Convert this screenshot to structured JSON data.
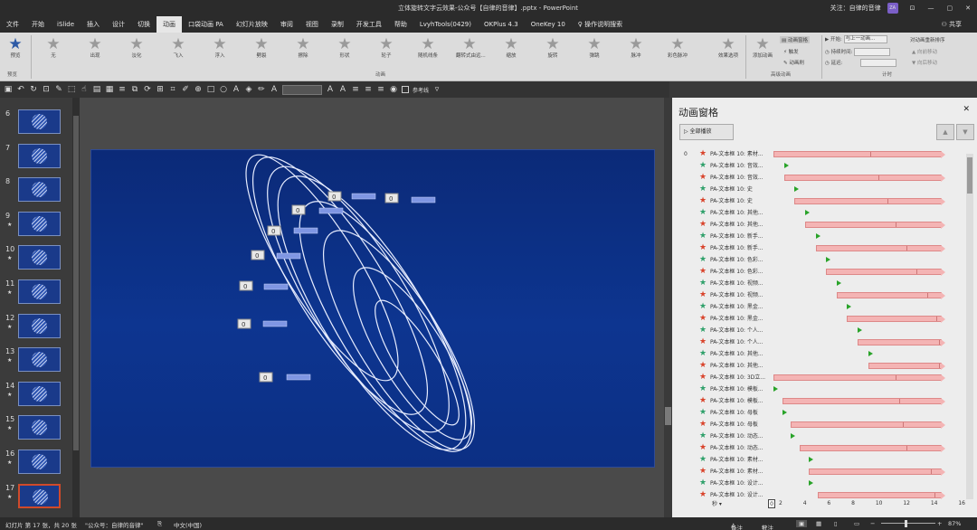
{
  "titlebar": {
    "title": "立体旋转文字云效果-公众号【自律的音律】.pptx - PowerPoint",
    "account": "关注：自律的音律",
    "avatar": "ZA",
    "minimize": "—",
    "restore": "▢",
    "close": "✕"
  },
  "tabs": [
    "文件",
    "开始",
    "iSlide",
    "插入",
    "设计",
    "切换",
    "动画",
    "口袋动画 PA",
    "幻灯片放映",
    "审阅",
    "视图",
    "录制",
    "开发工具",
    "帮助",
    "LvyhTools(0429)",
    "OKPlus 4.3",
    "OneKey 10",
    "操作说明搜索"
  ],
  "share": "共享",
  "ribbon": {
    "preview": {
      "label": "预览",
      "group": "预览"
    },
    "effects": [
      "无",
      "出现",
      "淡化",
      "飞入",
      "浮入",
      "劈裂",
      "擦除",
      "形状",
      "轮子",
      "随机线条",
      "翻转式由远...",
      "缩放",
      "旋转",
      "弹跳",
      "脉冲",
      "彩色脉冲"
    ],
    "effect_options": "效果选项",
    "group_anim": "动画",
    "add_anim": "添加动画",
    "anim_pane_btn": "动画窗格",
    "trigger": "触发",
    "anim_painter": "动画刷",
    "group_adv": "高级动画",
    "start_label": "开始:",
    "start_value": "与上一动画...",
    "duration_label": "持续时间:",
    "delay_label": "延迟:",
    "group_timing": "计时",
    "reorder": "对动画重新排序",
    "move_earlier": "向前移动",
    "move_later": "向后移动"
  },
  "qat": {
    "ref_label": "参考线"
  },
  "thumbnails": [
    {
      "num": "6",
      "star": ""
    },
    {
      "num": "7",
      "star": ""
    },
    {
      "num": "8",
      "star": ""
    },
    {
      "num": "9",
      "star": "★"
    },
    {
      "num": "10",
      "star": "★"
    },
    {
      "num": "11",
      "star": "★"
    },
    {
      "num": "12",
      "star": "★"
    },
    {
      "num": "13",
      "star": "★"
    },
    {
      "num": "14",
      "star": "★"
    },
    {
      "num": "15",
      "star": "★"
    },
    {
      "num": "16",
      "star": "★"
    },
    {
      "num": "17",
      "star": "★"
    }
  ],
  "slide": {
    "zero_label": "0"
  },
  "pane": {
    "title": "动画窗格",
    "close": "✕",
    "play_all": "全部播放",
    "up": "▲",
    "down": "▼",
    "rows": [
      {
        "idx": "0",
        "star": "red",
        "name": "PA-文本框 10: 素材...",
        "kind": "bar",
        "start": 0,
        "end": 0.96,
        "mark": 0.55
      },
      {
        "idx": "",
        "star": "green",
        "name": "PA-文本框 10: 音效...",
        "kind": "tri",
        "start": 0.06
      },
      {
        "idx": "",
        "star": "red",
        "name": "PA-文本框 10: 音效...",
        "kind": "bar",
        "start": 0.06,
        "end": 0.96,
        "mark": 0.6
      },
      {
        "idx": "",
        "star": "green",
        "name": "PA-文本框 10: 史",
        "kind": "tri",
        "start": 0.12
      },
      {
        "idx": "",
        "star": "red",
        "name": "PA-文本框 10: 史",
        "kind": "bar",
        "start": 0.12,
        "end": 0.96,
        "mark": 0.65
      },
      {
        "idx": "",
        "star": "green",
        "name": "PA-文本框 10: 其他...",
        "kind": "tri",
        "start": 0.18
      },
      {
        "idx": "",
        "star": "red",
        "name": "PA-文本框 10: 其他...",
        "kind": "bar",
        "start": 0.18,
        "end": 0.96,
        "mark": 0.7
      },
      {
        "idx": "",
        "star": "green",
        "name": "PA-文本框 10: 新手...",
        "kind": "tri",
        "start": 0.24
      },
      {
        "idx": "",
        "star": "red",
        "name": "PA-文本框 10: 新手...",
        "kind": "bar",
        "start": 0.24,
        "end": 0.96,
        "mark": 0.76
      },
      {
        "idx": "",
        "star": "green",
        "name": "PA-文本框 10: 色彩...",
        "kind": "tri",
        "start": 0.3
      },
      {
        "idx": "",
        "star": "red",
        "name": "PA-文本框 10: 色彩...",
        "kind": "bar",
        "start": 0.3,
        "end": 0.96,
        "mark": 0.82
      },
      {
        "idx": "",
        "star": "green",
        "name": "PA-文本框 10: 视频...",
        "kind": "tri",
        "start": 0.36
      },
      {
        "idx": "",
        "star": "red",
        "name": "PA-文本框 10: 视频...",
        "kind": "bar",
        "start": 0.36,
        "end": 0.96,
        "mark": 0.88
      },
      {
        "idx": "",
        "star": "green",
        "name": "PA-文本框 10: 黑金...",
        "kind": "tri",
        "start": 0.42
      },
      {
        "idx": "",
        "star": "red",
        "name": "PA-文本框 10: 黑金...",
        "kind": "bar",
        "start": 0.42,
        "end": 0.96,
        "mark": 0.93
      },
      {
        "idx": "",
        "star": "green",
        "name": "PA-文本框 10: 个人...",
        "kind": "tri",
        "start": 0.48
      },
      {
        "idx": "",
        "star": "red",
        "name": "PA-文本框 10: 个人...",
        "kind": "bar",
        "start": 0.48,
        "end": 0.96,
        "mark": 0.95
      },
      {
        "idx": "",
        "star": "green",
        "name": "PA-文本框 10: 其他...",
        "kind": "tri",
        "start": 0.54
      },
      {
        "idx": "",
        "star": "red",
        "name": "PA-文本框 10: 其他...",
        "kind": "bar",
        "start": 0.54,
        "end": 0.96,
        "mark": 0.95
      },
      {
        "idx": "",
        "star": "red",
        "name": "PA-文本框 10: 3D立...",
        "kind": "bar",
        "start": 0,
        "end": 0.96,
        "mark": 0.7
      },
      {
        "idx": "",
        "star": "green",
        "name": "PA-文本框 10: 模板...",
        "kind": "tri",
        "start": 0.0
      },
      {
        "idx": "",
        "star": "red",
        "name": "PA-文本框 10: 模板...",
        "kind": "bar",
        "start": 0.05,
        "end": 0.96,
        "mark": 0.72
      },
      {
        "idx": "",
        "star": "green",
        "name": "PA-文本框 10: 母板",
        "kind": "tri",
        "start": 0.05
      },
      {
        "idx": "",
        "star": "red",
        "name": "PA-文本框 10: 母板",
        "kind": "bar",
        "start": 0.1,
        "end": 0.96,
        "mark": 0.74
      },
      {
        "idx": "",
        "star": "green",
        "name": "PA-文本框 10: 动态...",
        "kind": "tri",
        "start": 0.1
      },
      {
        "idx": "",
        "star": "red",
        "name": "PA-文本框 10: 动态...",
        "kind": "bar",
        "start": 0.15,
        "end": 0.96,
        "mark": 0.76
      },
      {
        "idx": "",
        "star": "green",
        "name": "PA-文本框 10: 素材...",
        "kind": "tri",
        "start": 0.2
      },
      {
        "idx": "",
        "star": "red",
        "name": "PA-文本框 10: 素材...",
        "kind": "bar",
        "start": 0.2,
        "end": 0.96,
        "mark": 0.9
      },
      {
        "idx": "",
        "star": "green",
        "name": "PA-文本框 10: 设计...",
        "kind": "tri",
        "start": 0.2
      },
      {
        "idx": "",
        "star": "red",
        "name": "PA-文本框 10: 设计...",
        "kind": "bar",
        "start": 0.25,
        "end": 0.96,
        "mark": 0.92
      }
    ],
    "seconds_label": "秒 ▾",
    "ruler_zero": "0",
    "ruler_ticks": [
      "2",
      "4",
      "6",
      "8",
      "10",
      "12",
      "14",
      "16"
    ]
  },
  "status": {
    "slide_info": "幻灯片 第 17 张，共 20 张",
    "theme": "\"公众号：自律的音律\"",
    "lang": "中文(中国)",
    "notes": "备注",
    "comments": "批注",
    "zoom": "87%"
  }
}
